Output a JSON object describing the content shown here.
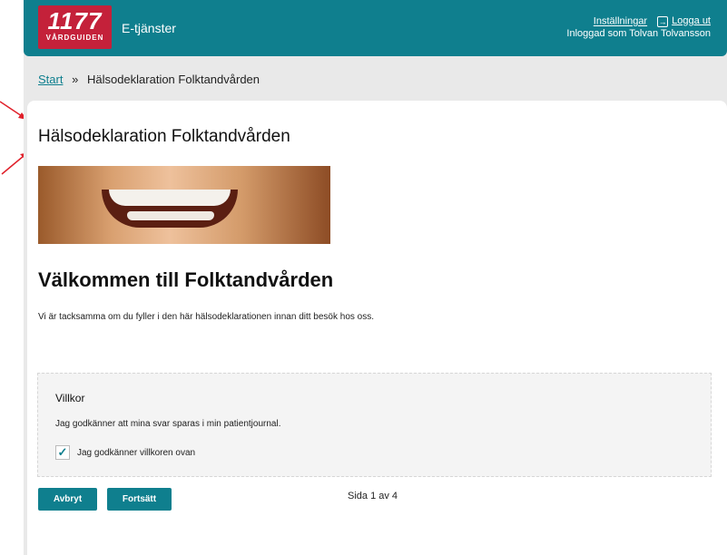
{
  "header": {
    "logo_number": "1177",
    "logo_text": "VÅRDGUIDEN",
    "app_title": "E-tjänster",
    "settings_link": "Inställningar",
    "logout_link": "Logga ut",
    "logged_in_text": "Inloggad som Tolvan Tolvansson"
  },
  "breadcrumb": {
    "start": "Start",
    "separator": "»",
    "current": "Hälsodeklaration Folktandvården"
  },
  "page": {
    "title": "Hälsodeklaration Folktandvården",
    "welcome_heading": "Välkommen till Folktandvården",
    "intro_text": "Vi är tacksamma om du fyller i den här hälsodeklarationen innan ditt besök hos oss."
  },
  "terms": {
    "title": "Villkor",
    "text": "Jag godkänner att mina svar sparas i min patientjournal.",
    "checkbox_label": "Jag godkänner villkoren ovan",
    "checkbox_checked": true
  },
  "actions": {
    "cancel_label": "Avbryt",
    "continue_label": "Fortsätt",
    "pager_text": "Sida 1 av 4"
  },
  "colors": {
    "brand_teal": "#0f7f8e",
    "logo_red": "#c4213a",
    "annotation_red": "#e0202a"
  }
}
